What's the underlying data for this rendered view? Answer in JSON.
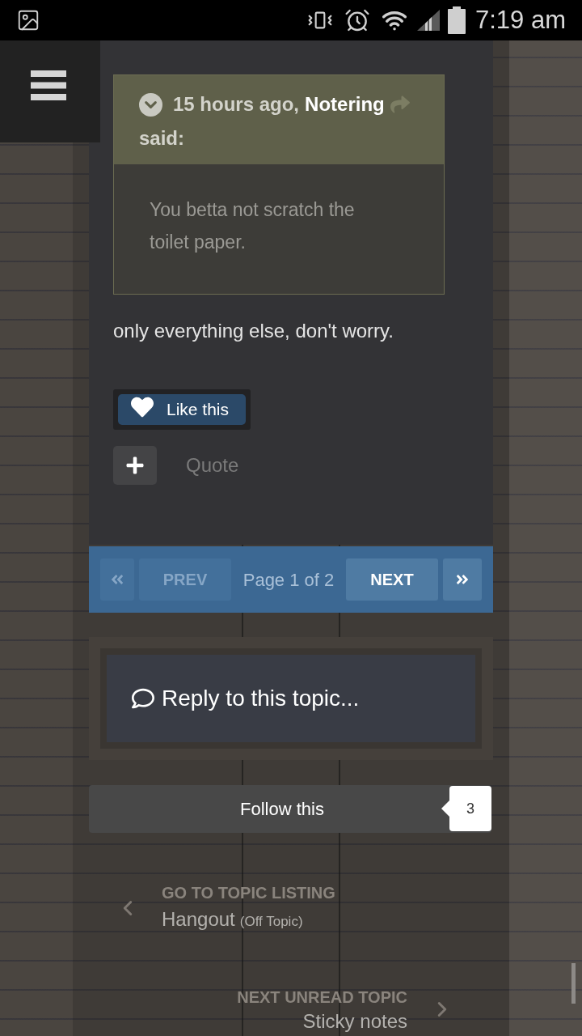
{
  "status_bar": {
    "time": "7:19 am"
  },
  "quote": {
    "timestamp": "15 hours ago,",
    "author": "Notering",
    "said": "said:",
    "text": "You betta not scratch the toilet paper."
  },
  "post": {
    "text": "only everything else, don't worry.",
    "like_button": {
      "label": "Like this"
    },
    "quote_button": {
      "label": "Quote"
    }
  },
  "pagination": {
    "first": {
      "disabled": true
    },
    "prev": {
      "label": "PREV",
      "disabled": true
    },
    "page_info": "Page 1 of 2",
    "next": {
      "label": "NEXT",
      "disabled": false
    },
    "last": {
      "disabled": false
    }
  },
  "reply": {
    "placeholder": "Reply to this topic..."
  },
  "follow": {
    "label": "Follow this",
    "count": "3"
  },
  "topic_nav": [
    {
      "kind": "previous",
      "caption": "GO TO TOPIC LISTING",
      "title": "Hangout",
      "note": "(Off Topic)"
    },
    {
      "kind": "next",
      "caption": "NEXT UNREAD TOPIC",
      "title": "Sticky notes"
    }
  ]
}
